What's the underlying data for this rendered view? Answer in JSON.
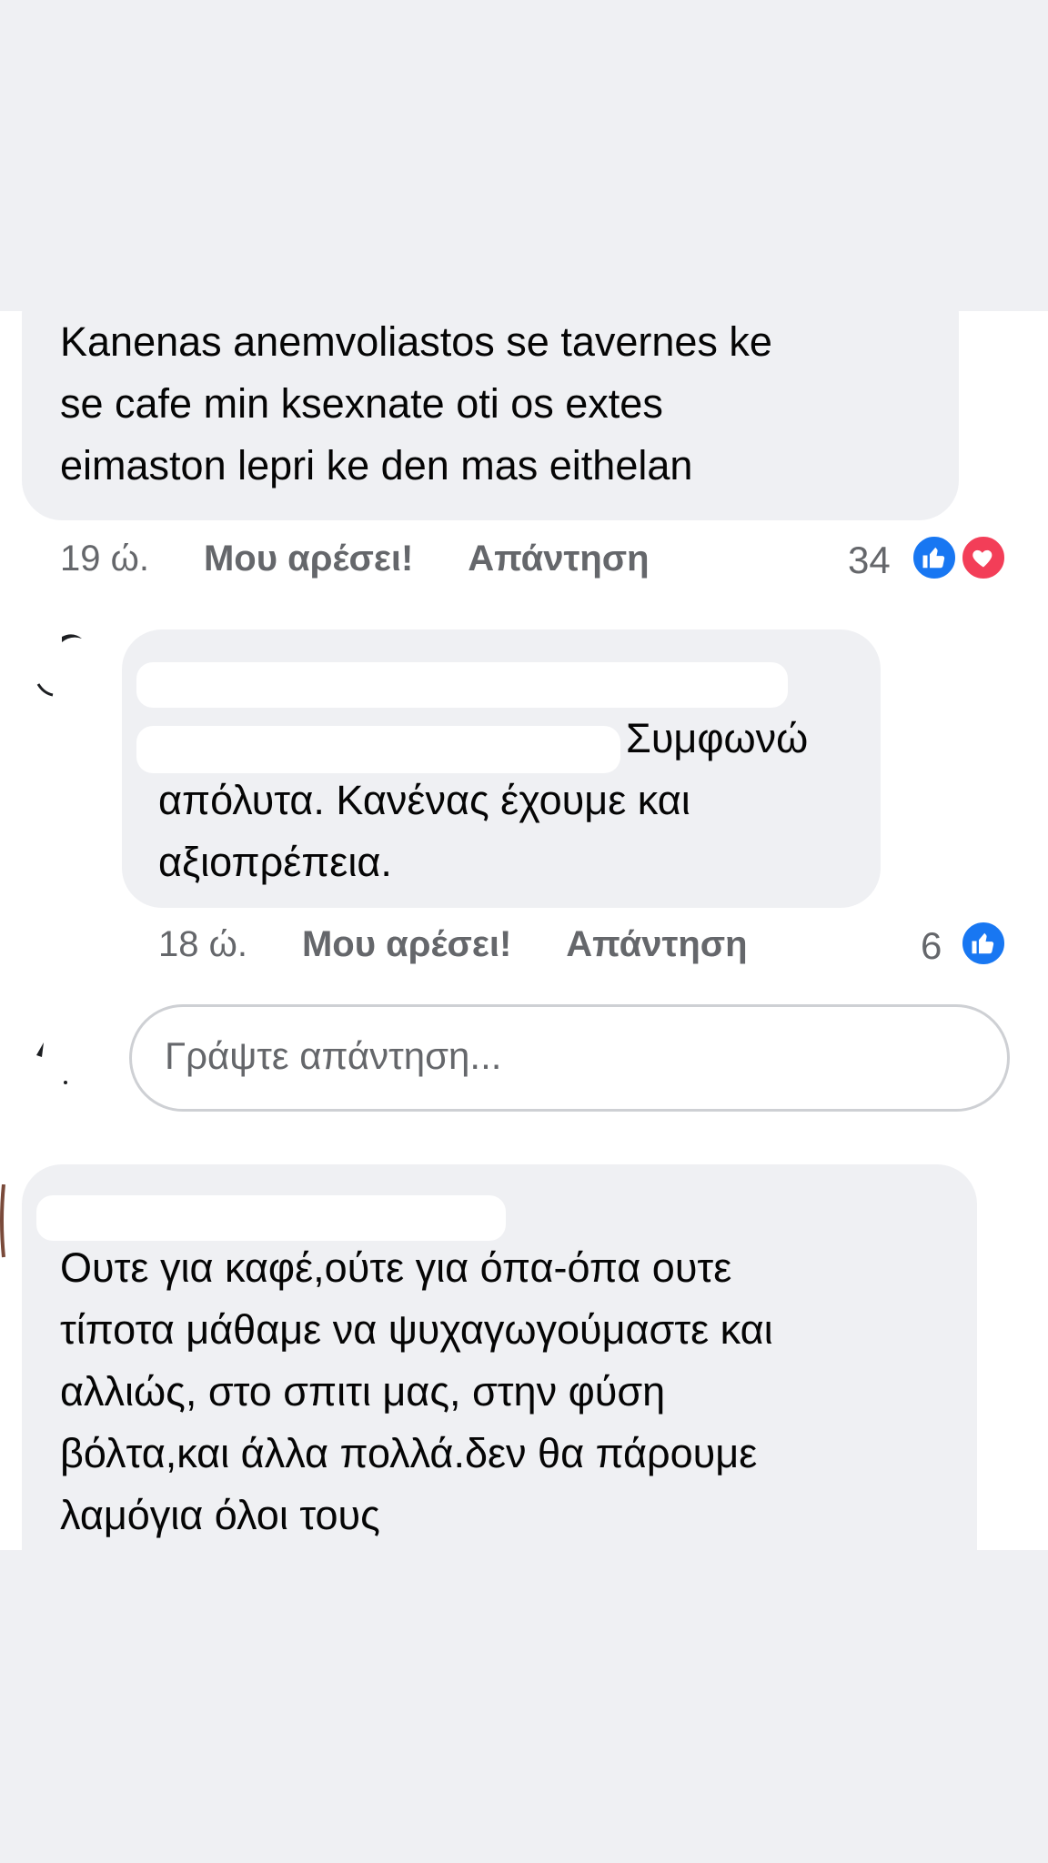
{
  "comments": [
    {
      "text_lines": [
        "Kanenas anemvoliastos se tavernes ke",
        "se cafe min ksexnate oti os extes",
        "eimaston lepri ke den mas eithelan"
      ],
      "time": "19 ώ.",
      "like_label": "Μου αρέσει!",
      "reply_label": "Απάντηση",
      "reaction_count": "34",
      "reactions": [
        "like-icon",
        "love-icon"
      ]
    },
    {
      "text_line1_suffix": "Συμφωνώ",
      "text_lines": [
        "απόλυτα. Κανένας έχουμε και",
        "αξιοπρέπεια."
      ],
      "time": "18 ώ.",
      "like_label": "Μου αρέσει!",
      "reply_label": "Απάντηση",
      "reaction_count": "6",
      "reactions": [
        "like-icon"
      ]
    },
    {
      "text_lines": [
        "Ουτε για καφέ,ούτε για όπα-όπα ουτε",
        "τίποτα μάθαμε να ψυχαγωγούμαστε και",
        "αλλιώς, στο σπιτι μας, στην φύση",
        "βόλτα,και άλλα πολλά.δεν θα πάρουμε",
        "λαμόγια όλοι τους"
      ]
    }
  ],
  "reply_input": {
    "placeholder": "Γράψτε απάντηση..."
  },
  "colors": {
    "page_bg": "#eff0f3",
    "panel_bg": "#ffffff",
    "bubble_bg": "#eff0f3",
    "like_blue": "#1877f2",
    "love_red": "#f33e58",
    "meta_gray": "#65676b",
    "mention_blue": "#216fdb"
  }
}
